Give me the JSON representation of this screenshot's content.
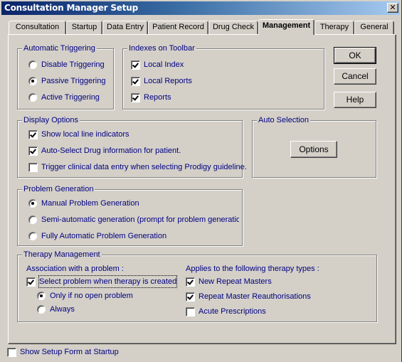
{
  "window": {
    "title": "Consultation Manager Setup",
    "close_icon": "close-x-icon"
  },
  "tabs": [
    {
      "label": "Consultation",
      "active": false
    },
    {
      "label": "Startup",
      "active": false
    },
    {
      "label": "Data Entry",
      "active": false
    },
    {
      "label": "Patient Record",
      "active": false
    },
    {
      "label": "Drug Check",
      "active": false
    },
    {
      "label": "Management",
      "active": true
    },
    {
      "label": "Therapy",
      "active": false
    },
    {
      "label": "General",
      "active": false
    }
  ],
  "automatic_triggering": {
    "title": "Automatic Triggering",
    "options": [
      {
        "label": "Disable Triggering",
        "selected": false
      },
      {
        "label": "Passive Triggering",
        "selected": true
      },
      {
        "label": "Active Triggering",
        "selected": false
      }
    ]
  },
  "indexes_on_toolbar": {
    "title": "Indexes on Toolbar",
    "items": [
      {
        "label": "Local Index",
        "checked": true
      },
      {
        "label": "Local Reports",
        "checked": true
      },
      {
        "label": "Reports",
        "checked": true
      }
    ]
  },
  "buttons": {
    "ok": "OK",
    "cancel": "Cancel",
    "help": "Help"
  },
  "display_options": {
    "title": "Display Options",
    "items": [
      {
        "label": "Show local line indicators",
        "checked": true
      },
      {
        "label": "Auto-Select Drug information for patient.",
        "checked": true
      },
      {
        "label": "Trigger clinical data entry when selecting Prodigy guideline.",
        "checked": false
      }
    ]
  },
  "auto_selection": {
    "title": "Auto Selection",
    "options_button": "Options"
  },
  "problem_generation": {
    "title": "Problem Generation",
    "options": [
      {
        "label": "Manual Problem Generation",
        "selected": true
      },
      {
        "label": "Semi-automatic generation (prompt for problem generation)",
        "selected": false
      },
      {
        "label": "Fully Automatic Problem Generation",
        "selected": false
      }
    ]
  },
  "therapy_management": {
    "title": "Therapy Management",
    "association_label": "Association with a problem :",
    "select_problem": {
      "label": "Select problem when therapy is created",
      "checked": true
    },
    "association_options": [
      {
        "label": "Only if no open problem",
        "selected": true
      },
      {
        "label": "Always",
        "selected": false
      }
    ],
    "applies_label": "Applies to the following therapy types :",
    "therapy_types": [
      {
        "label": "New Repeat Masters",
        "checked": true
      },
      {
        "label": "Repeat Master Reauthorisations",
        "checked": true
      },
      {
        "label": "Acute Prescriptions",
        "checked": false
      }
    ]
  },
  "footer": {
    "show_setup_form": {
      "label": "Show Setup Form at Startup",
      "checked": false
    }
  }
}
